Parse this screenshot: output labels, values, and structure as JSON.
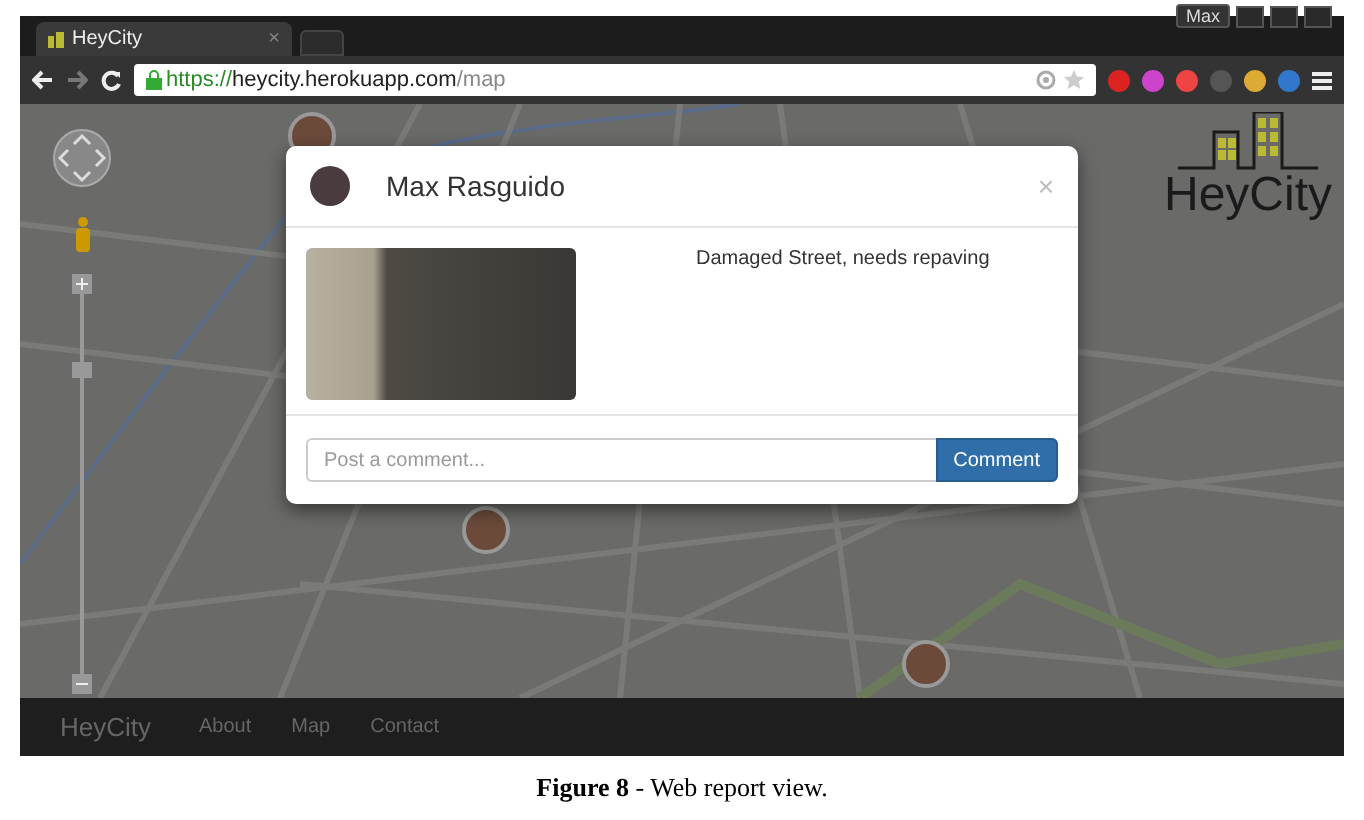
{
  "browser": {
    "tab_title": "HeyCity",
    "tab_close": "×",
    "profile": "Max",
    "url_scheme": "https://",
    "url_host": "heycity.herokuapp.com",
    "url_path": "/map"
  },
  "map": {
    "logo": "HeyCity",
    "zoom": {
      "level": 0.8
    }
  },
  "modal": {
    "user": "Max Rasguido",
    "close": "×",
    "description": "Damaged Street, needs repaving",
    "comment_placeholder": "Post a comment...",
    "comment_button": "Comment"
  },
  "navbar": {
    "brand": "HeyCity",
    "links": [
      "About",
      "Map",
      "Contact"
    ]
  },
  "caption": "**Figure 8** - Web report view."
}
